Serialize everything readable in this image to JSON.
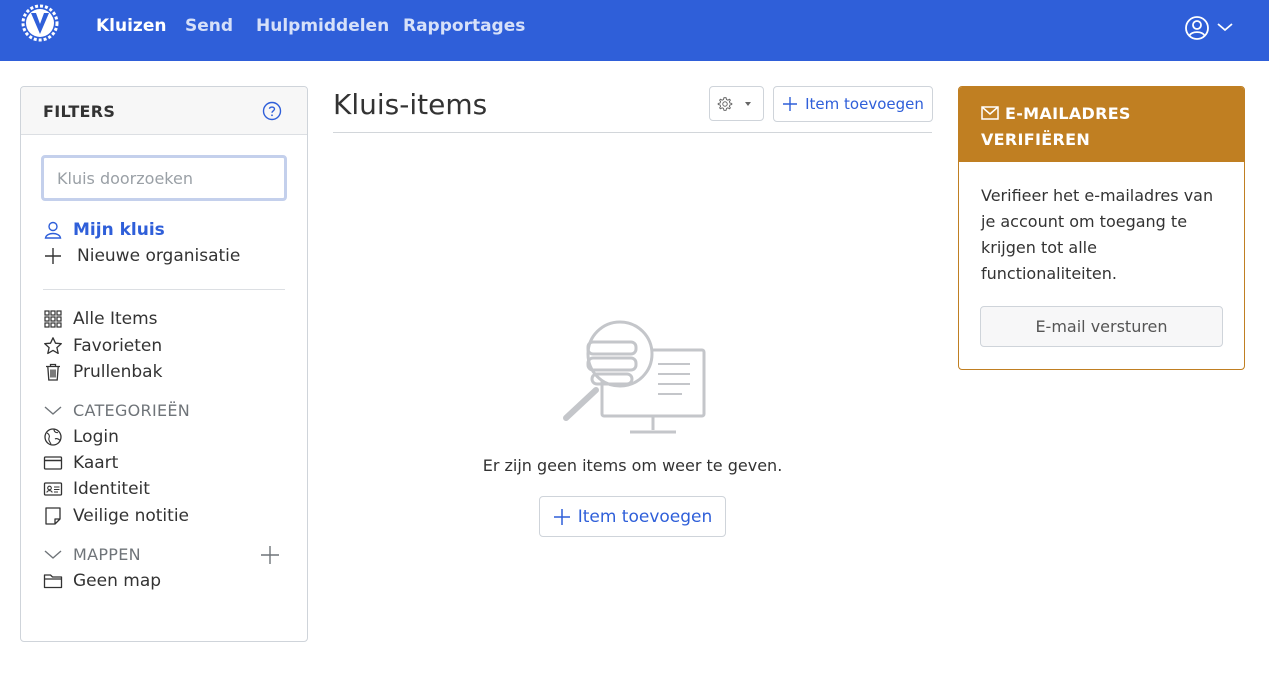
{
  "nav": {
    "items": [
      {
        "label": "Kluizen",
        "active": true
      },
      {
        "label": "Send",
        "active": false
      },
      {
        "label": "Hulpmiddelen",
        "active": false
      },
      {
        "label": "Rapportages",
        "active": false
      }
    ],
    "logo_icon": "shield-v-logo-icon",
    "account_icon": "user-circle-icon"
  },
  "filters": {
    "title": "FILTERS",
    "help_icon": "question-circle-icon",
    "search_placeholder": "Kluis doorzoeken",
    "vaults": [
      {
        "label": "Mijn kluis",
        "icon": "user-icon",
        "selected": true
      },
      {
        "label": "Nieuwe organisatie",
        "icon": "plus-icon",
        "selected": false
      }
    ],
    "types": [
      {
        "label": "Alle Items",
        "icon": "grid-icon"
      },
      {
        "label": "Favorieten",
        "icon": "star-icon"
      },
      {
        "label": "Prullenbak",
        "icon": "trash-icon"
      }
    ],
    "categories_label": "CATEGORIEËN",
    "categories": [
      {
        "label": "Login",
        "icon": "globe-icon"
      },
      {
        "label": "Kaart",
        "icon": "credit-card-icon"
      },
      {
        "label": "Identiteit",
        "icon": "id-card-icon"
      },
      {
        "label": "Veilige notitie",
        "icon": "sticky-note-icon"
      }
    ],
    "folders_label": "MAPPEN",
    "folders": [
      {
        "label": "Geen map",
        "icon": "folder-icon"
      }
    ]
  },
  "main": {
    "title": "Kluis-items",
    "add_item_label": "Item toevoegen",
    "empty_text": "Er zijn geen items om weer te geven.",
    "empty_add_label": "Item toevoegen"
  },
  "verify": {
    "title": "E-MAILADRES VERIFIËREN",
    "body": "Verifieer het e-mailadres van je account om toegang te krijgen tot alle functionaliteiten.",
    "button_label": "E-mail versturen"
  },
  "colors": {
    "nav_bg": "#2f5fd9",
    "accent": "#2f5fd9",
    "warning": "#c07f22"
  }
}
